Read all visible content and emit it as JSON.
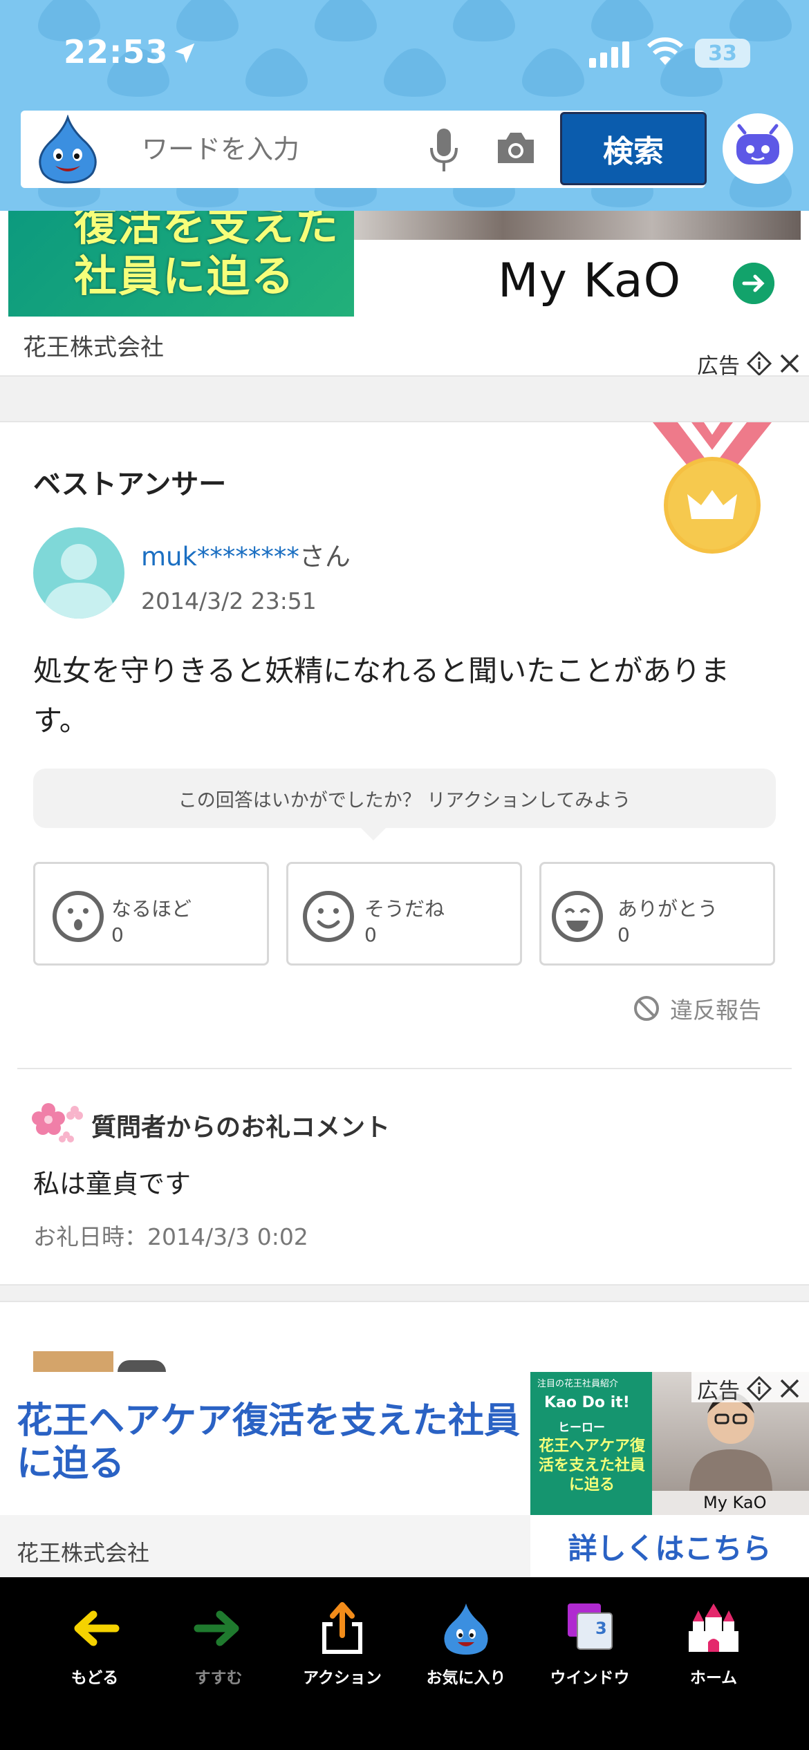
{
  "status_bar": {
    "time": "22:53",
    "battery": "33"
  },
  "search": {
    "placeholder": "ワードを入力",
    "button_label": "検索"
  },
  "ad_top": {
    "banner_line1": "復活を支えた",
    "banner_line2": "社員に迫る",
    "brand": "My KaO",
    "company": "花王株式会社",
    "label": "広告"
  },
  "best_answer": {
    "section_title": "ベストアンサー",
    "user_name": "muk********",
    "user_suffix": "さん",
    "date": "2014/3/2 23:51",
    "text": "処女を守りきると妖精になれると聞いたことがあります。",
    "reaction_prompt": "この回答はいかがでしたか？ リアクションしてみよう",
    "reactions": [
      {
        "label": "なるほど",
        "count": "0"
      },
      {
        "label": "そうだね",
        "count": "0"
      },
      {
        "label": "ありがとう",
        "count": "0"
      }
    ],
    "report_label": "違反報告"
  },
  "thanks": {
    "title": "質問者からのお礼コメント",
    "text": "私は童貞です",
    "date": "お礼日時：2014/3/3 0:02"
  },
  "ad_bottom": {
    "headline": "花王ヘアケア復活を支えた社員に迫る",
    "company": "花王株式会社",
    "cta": "詳しくはこちら",
    "label": "広告",
    "image_tag": "注目の花王社員紹介",
    "image_title": "Kao Do it!",
    "image_sub": "ヒーロー",
    "image_text": "花王ヘアケア復活を支えた社員に迫る",
    "image_brand": "My KaO"
  },
  "toolbar": {
    "items": [
      {
        "label": "もどる"
      },
      {
        "label": "すすむ"
      },
      {
        "label": "アクション"
      },
      {
        "label": "お気に入り"
      },
      {
        "label": "ウインドウ",
        "badge": "3"
      },
      {
        "label": "ホーム"
      }
    ]
  },
  "colors": {
    "header_bg": "#7dc6f0",
    "search_button": "#0b5cad",
    "link_blue": "#1b6fc2",
    "ad_headline": "#2a62c4"
  }
}
